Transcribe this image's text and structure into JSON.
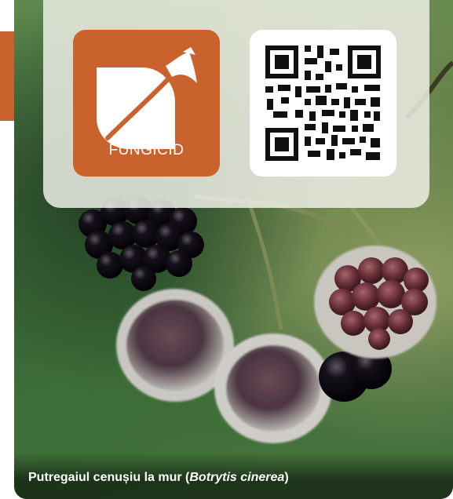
{
  "badge": {
    "label": "FUNGICID",
    "icon": "leaf-icon",
    "color": "#c9622c"
  },
  "qr": {
    "icon": "qr-code-icon"
  },
  "caption": {
    "prefix": "Putregaiul cenușiu la mur (",
    "scientific_name": "Botrytis cinerea",
    "suffix": ")"
  },
  "colors": {
    "accent": "#c9622c"
  }
}
